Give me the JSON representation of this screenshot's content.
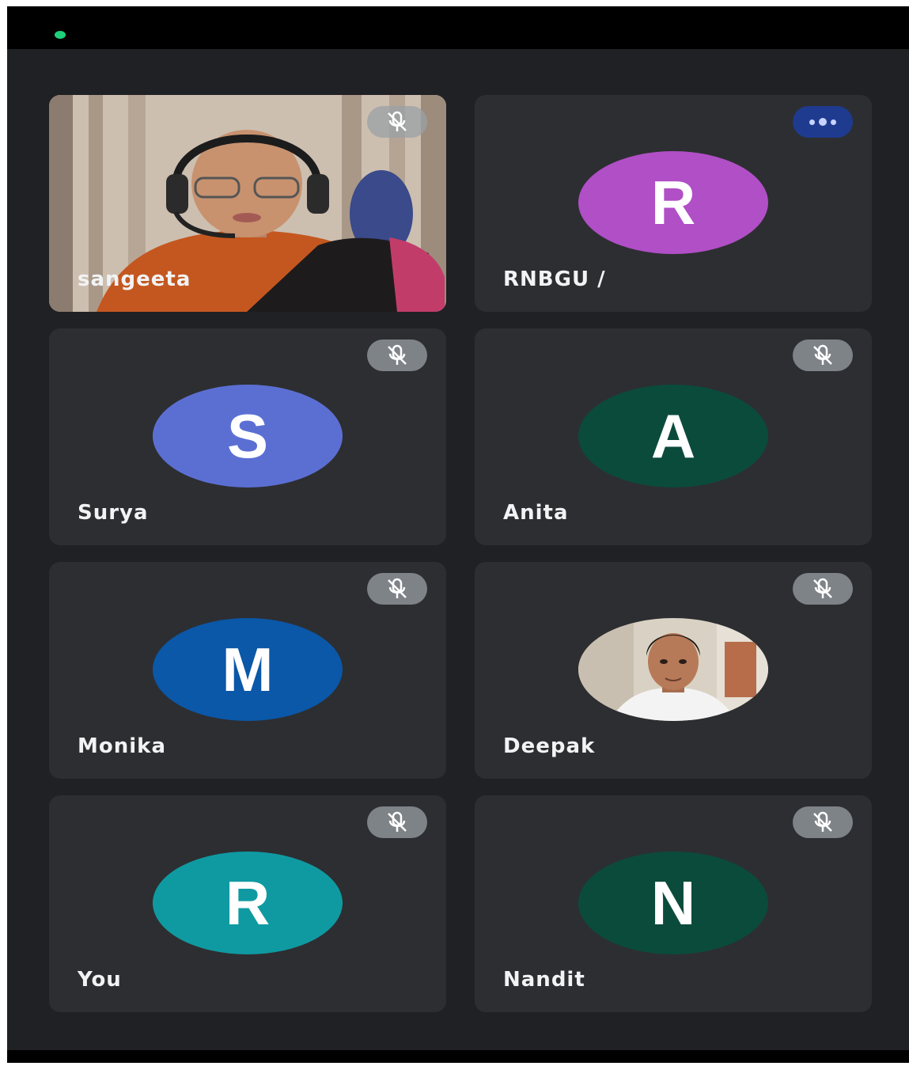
{
  "participants": [
    {
      "name": "sangeeta",
      "type": "video",
      "status_icon": "mic-off-icon"
    },
    {
      "name": "RNBGU /",
      "type": "avatar",
      "initial": "R",
      "avatar_color": "#b04fc6",
      "status_icon": "more-dots-icon"
    },
    {
      "name": "Surya",
      "type": "avatar",
      "initial": "S",
      "avatar_color": "#5b6fd3",
      "status_icon": "mic-off-icon"
    },
    {
      "name": "Anita",
      "type": "avatar",
      "initial": "A",
      "avatar_color": "#0b4b3c",
      "status_icon": "mic-off-icon"
    },
    {
      "name": "Monika",
      "type": "avatar",
      "initial": "M",
      "avatar_color": "#0b57a8",
      "status_icon": "mic-off-icon"
    },
    {
      "name": "Deepak",
      "type": "photo",
      "status_icon": "mic-off-icon"
    },
    {
      "name": "You",
      "type": "avatar",
      "initial": "R",
      "avatar_color": "#0f9aa2",
      "status_icon": "mic-off-icon"
    },
    {
      "name": "Nandit",
      "type": "avatar",
      "initial": "N",
      "avatar_color": "#0b4b3c",
      "status_icon": "mic-off-icon"
    }
  ],
  "colors": {
    "background": "#202124",
    "tile": "#2d2e31",
    "status_bar": "#000000",
    "indicator": "#1ed07a"
  }
}
